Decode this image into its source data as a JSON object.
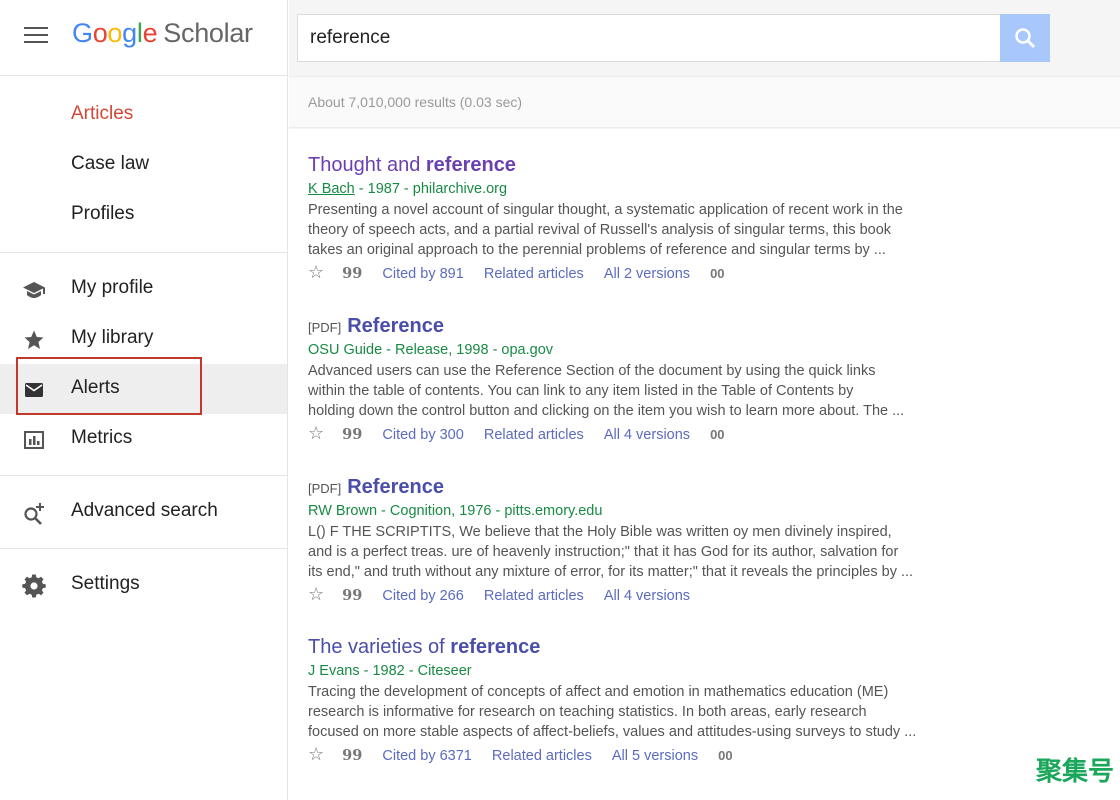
{
  "logo": {
    "google": "Google",
    "scholar": "Scholar"
  },
  "sidebar": {
    "section1": [
      {
        "label": "Articles"
      },
      {
        "label": "Case law"
      },
      {
        "label": "Profiles"
      }
    ],
    "section2": [
      {
        "label": "My profile",
        "icon": "graduation-cap-icon"
      },
      {
        "label": "My library",
        "icon": "star-icon"
      },
      {
        "label": "Alerts",
        "icon": "envelope-icon"
      },
      {
        "label": "Metrics",
        "icon": "bar-chart-icon"
      }
    ],
    "advanced": {
      "label": "Advanced search",
      "icon": "search-plus-icon"
    },
    "settings": {
      "label": "Settings",
      "icon": "gear-icon"
    }
  },
  "search": {
    "value": "reference"
  },
  "results_count": "About 7,010,000 results (0.03 sec)",
  "results": [
    {
      "tag": "",
      "title_pre": "Thought and ",
      "title_bold": "reference",
      "title_post": "",
      "author": "K Bach",
      "meta_rest": " - 1987 - philarchive.org",
      "snippet": [
        "Presenting a novel account of singular thought, a systematic application of recent work in the",
        "theory of speech acts, and a partial revival of Russell's analysis of singular terms, this book",
        "takes an original approach to the perennial problems of reference and singular terms by ..."
      ],
      "cited": "Cited by 891",
      "related": "Related articles",
      "versions": "All 2 versions"
    },
    {
      "tag": "[PDF]",
      "title_pre": "",
      "title_bold": "Reference",
      "title_post": "",
      "author": "",
      "meta_rest": "OSU Guide - Release, 1998 - opa.gov",
      "snippet": [
        "Advanced users can use the Reference Section of the document by using the quick links",
        "within the table of contents. You can link to any item listed in the Table of Contents by",
        "holding down the control button and clicking on the item you wish to learn more about. The ..."
      ],
      "cited": "Cited by 300",
      "related": "Related articles",
      "versions": "All 4 versions"
    },
    {
      "tag": "[PDF]",
      "title_pre": "",
      "title_bold": "Reference",
      "title_post": "",
      "author": "",
      "meta_rest": "RW Brown - Cognition, 1976 - pitts.emory.edu",
      "snippet": [
        "L() F THE SCRIPTITS, We believe that the Holy Bible was written oy men divinely inspired,",
        "and is a perfect treas. ure of heavenly instruction;\" that it has God for its author, salvation for",
        "its end,\" and truth without any mixture of error, for its matter;\" that it reveals the principles by ..."
      ],
      "cited": "Cited by 266",
      "related": "Related articles",
      "versions": "All 4 versions"
    },
    {
      "tag": "",
      "title_pre": "The varieties of ",
      "title_bold": "reference",
      "title_post": "",
      "author": "",
      "meta_rest": "J Evans - 1982 - Citeseer",
      "snippet": [
        "Tracing the development of concepts of affect and emotion in mathematics education (ME)",
        "research is informative for research on teaching statistics. In both areas, early research",
        "focused on more stable aspects of affect-beliefs, values and attitudes-using surveys to study ..."
      ],
      "cited": "Cited by 6371",
      "related": "Related articles",
      "versions": "All 5 versions"
    }
  ],
  "action_icons": {
    "star": "☆",
    "quote": "99",
    "more": "00"
  },
  "watermark": "聚集号",
  "colors": {
    "accent_red": "#d14836",
    "link_blue": "#4a4ea8",
    "visited_purple": "#6a3fb0",
    "meta_green": "#198a44",
    "search_btn": "#a8c7fa"
  }
}
